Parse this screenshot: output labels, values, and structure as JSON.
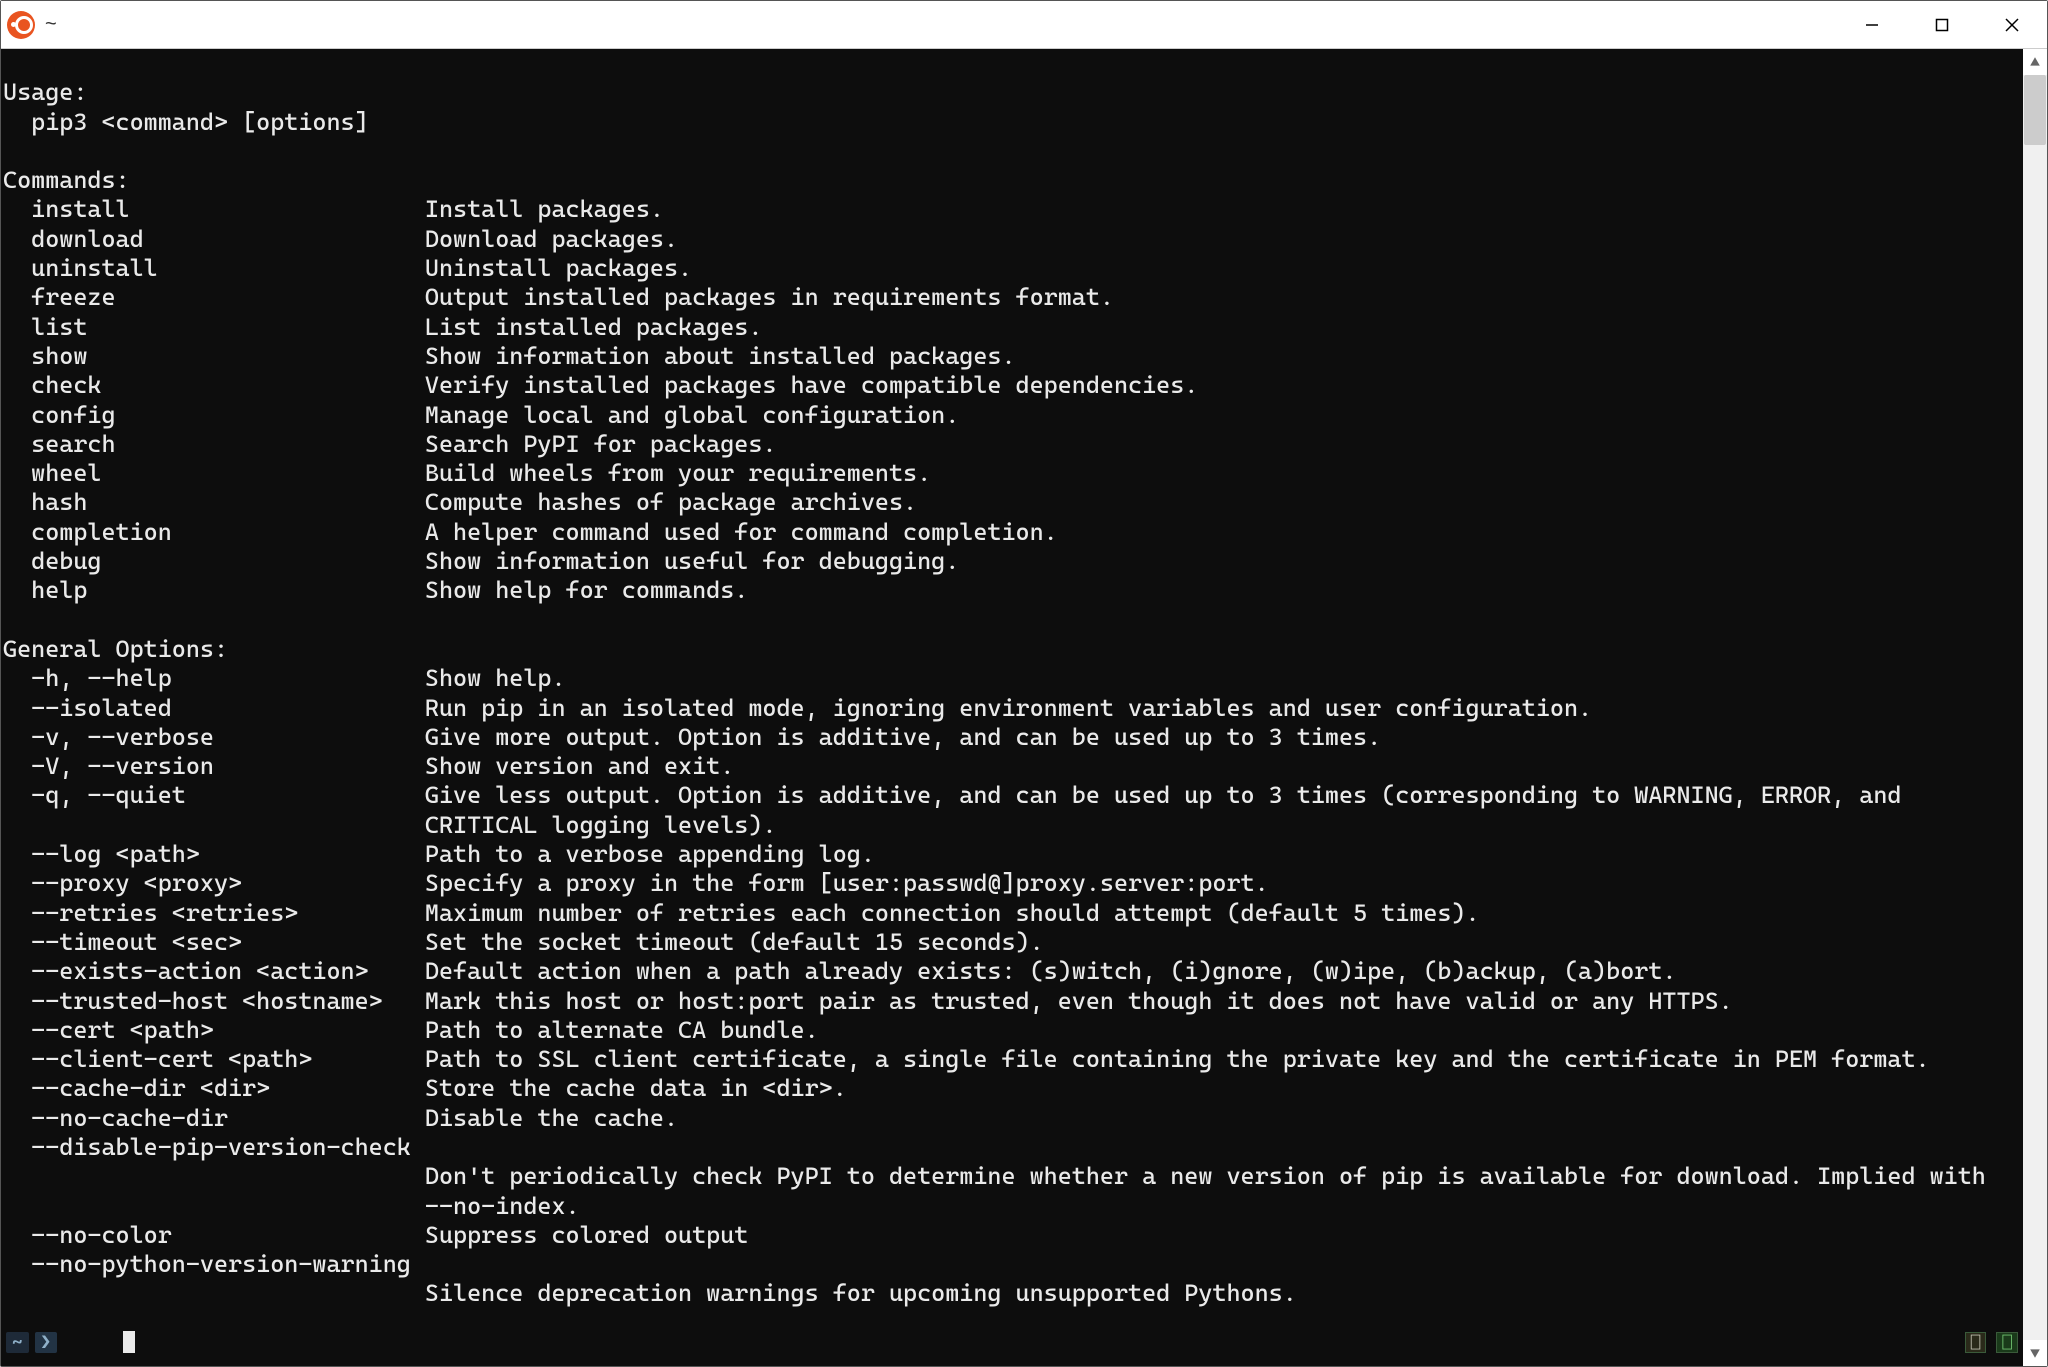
{
  "window": {
    "title": "~"
  },
  "usage": {
    "header": "Usage:",
    "line": "  pip3 <command> [options]"
  },
  "commands": {
    "header": "Commands:",
    "items": [
      {
        "name": "install",
        "desc": "Install packages."
      },
      {
        "name": "download",
        "desc": "Download packages."
      },
      {
        "name": "uninstall",
        "desc": "Uninstall packages."
      },
      {
        "name": "freeze",
        "desc": "Output installed packages in requirements format."
      },
      {
        "name": "list",
        "desc": "List installed packages."
      },
      {
        "name": "show",
        "desc": "Show information about installed packages."
      },
      {
        "name": "check",
        "desc": "Verify installed packages have compatible dependencies."
      },
      {
        "name": "config",
        "desc": "Manage local and global configuration."
      },
      {
        "name": "search",
        "desc": "Search PyPI for packages."
      },
      {
        "name": "wheel",
        "desc": "Build wheels from your requirements."
      },
      {
        "name": "hash",
        "desc": "Compute hashes of package archives."
      },
      {
        "name": "completion",
        "desc": "A helper command used for command completion."
      },
      {
        "name": "debug",
        "desc": "Show information useful for debugging."
      },
      {
        "name": "help",
        "desc": "Show help for commands."
      }
    ]
  },
  "options": {
    "header": "General Options:",
    "items": [
      {
        "flag": "-h, --help",
        "desc": "Show help."
      },
      {
        "flag": "--isolated",
        "desc": "Run pip in an isolated mode, ignoring environment variables and user configuration."
      },
      {
        "flag": "-v, --verbose",
        "desc": "Give more output. Option is additive, and can be used up to 3 times."
      },
      {
        "flag": "-V, --version",
        "desc": "Show version and exit."
      },
      {
        "flag": "-q, --quiet",
        "desc": "Give less output. Option is additive, and can be used up to 3 times (corresponding to WARNING, ERROR, and\n                              CRITICAL logging levels)."
      },
      {
        "flag": "--log <path>",
        "desc": "Path to a verbose appending log."
      },
      {
        "flag": "--proxy <proxy>",
        "desc": "Specify a proxy in the form [user:passwd@]proxy.server:port."
      },
      {
        "flag": "--retries <retries>",
        "desc": "Maximum number of retries each connection should attempt (default 5 times)."
      },
      {
        "flag": "--timeout <sec>",
        "desc": "Set the socket timeout (default 15 seconds)."
      },
      {
        "flag": "--exists-action <action>",
        "desc": "Default action when a path already exists: (s)witch, (i)gnore, (w)ipe, (b)ackup, (a)bort."
      },
      {
        "flag": "--trusted-host <hostname>",
        "desc": "Mark this host or host:port pair as trusted, even though it does not have valid or any HTTPS."
      },
      {
        "flag": "--cert <path>",
        "desc": "Path to alternate CA bundle."
      },
      {
        "flag": "--client-cert <path>",
        "desc": "Path to SSL client certificate, a single file containing the private key and the certificate in PEM format."
      },
      {
        "flag": "--cache-dir <dir>",
        "desc": "Store the cache data in <dir>."
      },
      {
        "flag": "--no-cache-dir",
        "desc": "Disable the cache."
      },
      {
        "flag": "--disable-pip-version-check",
        "desc": "\n                              Don't periodically check PyPI to determine whether a new version of pip is available for download. Implied with\n                              --no-index."
      },
      {
        "flag": "--no-color",
        "desc": "Suppress colored output"
      },
      {
        "flag": "--no-python-version-warning",
        "desc": "\n                              Silence deprecation warnings for upcoming unsupported Pythons."
      }
    ]
  },
  "statusbar": {
    "left_badge": "~",
    "left_badge2": "❯",
    "right_box1": "⎕",
    "right_box2": "⎕"
  }
}
